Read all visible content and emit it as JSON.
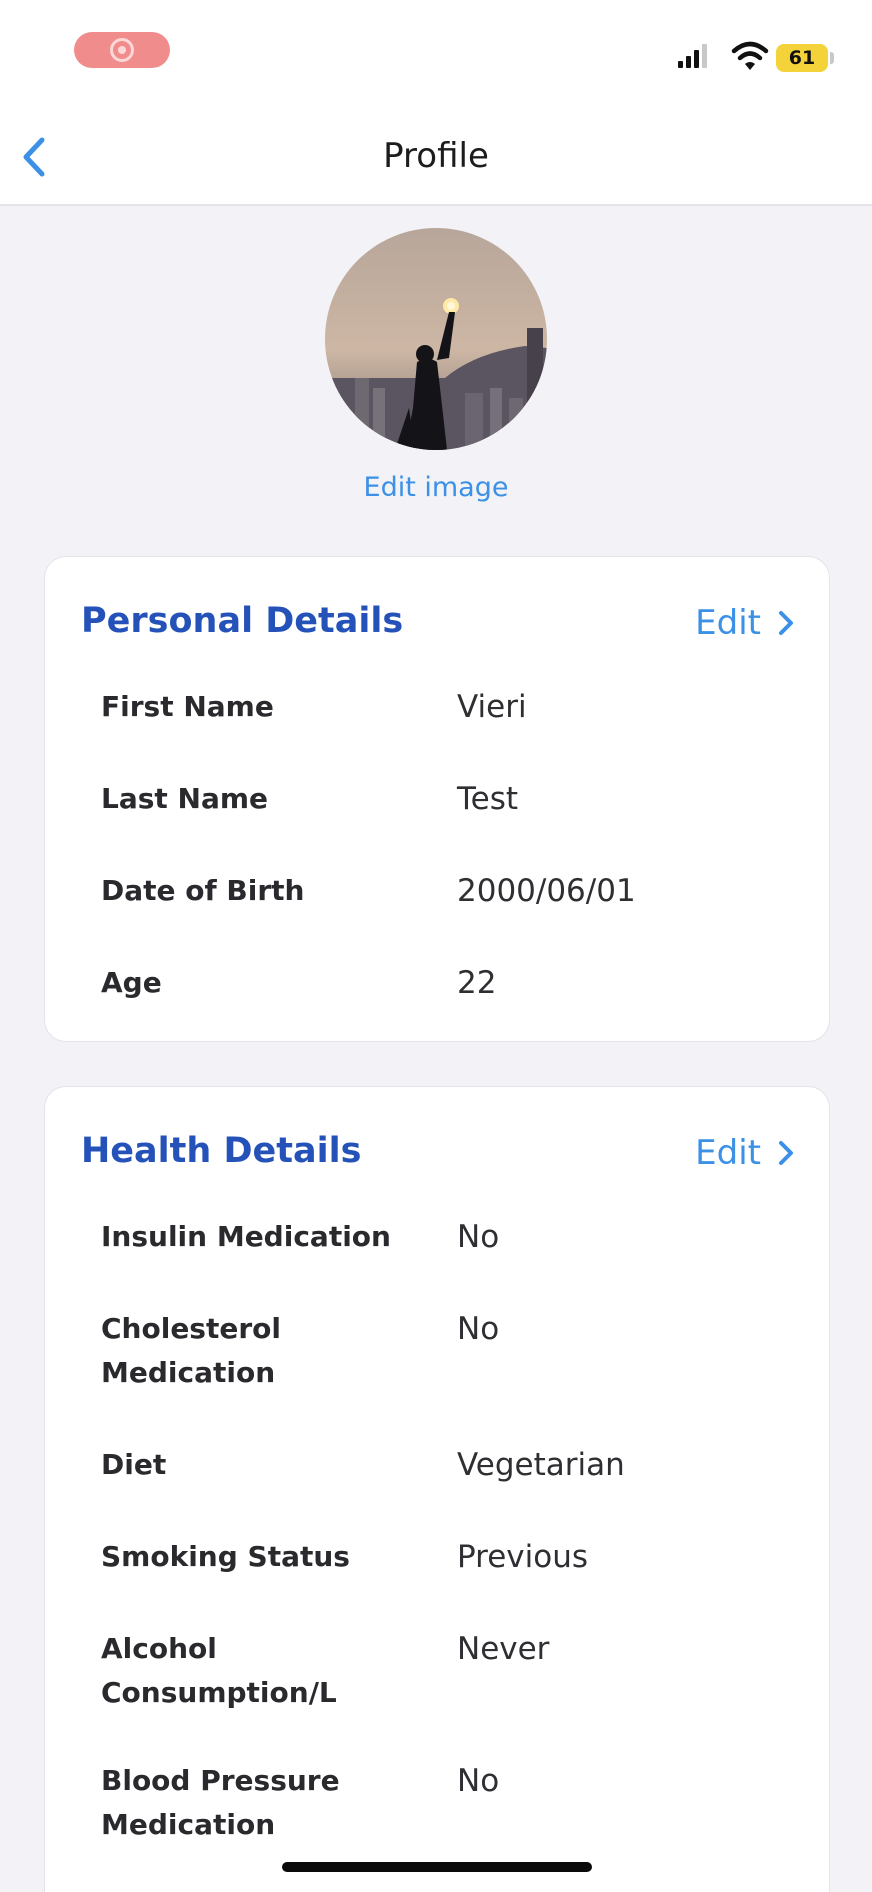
{
  "status_bar": {
    "battery": "61",
    "icons": [
      "record-indicator-icon",
      "cellular-signal-icon",
      "wifi-icon",
      "battery-icon"
    ]
  },
  "nav": {
    "title": "Profile",
    "back_icon": "chevron-left-icon"
  },
  "avatar": {
    "edit_label": "Edit image"
  },
  "personal": {
    "title": "Personal Details",
    "edit_label": "Edit",
    "rows": [
      {
        "label": "First Name",
        "value": "Vieri"
      },
      {
        "label": "Last Name",
        "value": "Test"
      },
      {
        "label": "Date of Birth",
        "value": "2000/06/01"
      },
      {
        "label": "Age",
        "value": "22"
      }
    ]
  },
  "health": {
    "title": "Health Details",
    "edit_label": "Edit",
    "rows": [
      {
        "label": "Insulin Medication",
        "value": "No"
      },
      {
        "label": "Cholesterol Medication",
        "value": "No"
      },
      {
        "label": "Diet",
        "value": "Vegetarian"
      },
      {
        "label": "Smoking Status",
        "value": "Previous"
      },
      {
        "label": "Alcohol Consumption/L",
        "value": "Never"
      },
      {
        "label": "Blood Pressure Medication",
        "value": "No"
      }
    ]
  },
  "colors": {
    "accent": "#3c91e6",
    "section_title": "#2552b8",
    "background": "#f2f2f7",
    "record_pill": "#f08c8c",
    "battery": "#f3d23a"
  }
}
